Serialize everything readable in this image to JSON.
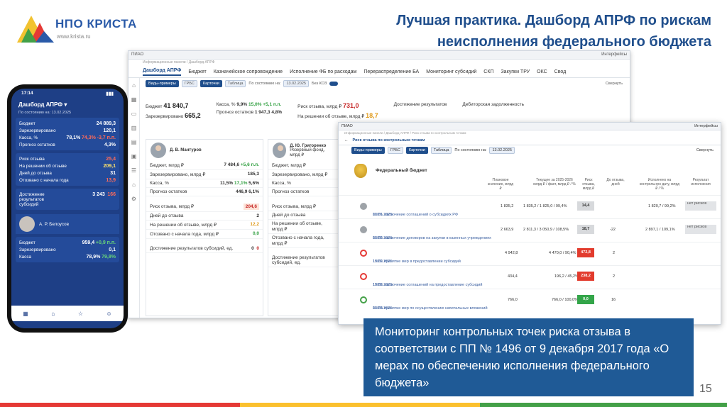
{
  "logo": {
    "name": "НПО КРИСТА",
    "url": "www.krista.ru"
  },
  "slide_title": "Лучшая практика. Дашборд АПРФ по рискам неисполнения федерального бюджета",
  "dashboard": {
    "app": "ПИАО",
    "user": "Интерфейсы",
    "breadcrumb": "Информационные панели / Дашборд АПРФ",
    "tabs": [
      "Дашборд АПРФ",
      "Бюджет",
      "Казначейское сопровождение",
      "Исполнение ФБ по расходам",
      "Перераспределение БА",
      "Мониторинг субсидий",
      "СКП",
      "Закупки ТРУ",
      "ОКС",
      "Свод"
    ],
    "filters": {
      "view1": "Виды-примеры",
      "view2": "ГРБС",
      "view3": "Карточки",
      "view4": "Таблица",
      "date_label": "По состоянию на:",
      "date": "13.02.2025",
      "extra": "Без КОЗ",
      "collapse": "Свернуть"
    },
    "summary": {
      "budget_label": "Бюджет",
      "budget_value": "41 840,7",
      "reserved_label": "Зарезервировано",
      "reserved_value": "665,2",
      "cash_label": "Касса, %",
      "cash_value": "9,9%",
      "cash_plan": "15,0%",
      "cash_delta": "+5,1 п.п.",
      "forecast_label": "Прогноз остатков",
      "forecast_value": "1 947,3",
      "forecast_pct": "4,8%",
      "risk_label": "Риск отзыва, млрд ₽",
      "risk_value": "731,0",
      "decision_label": "На решении об отзыве, млрд ₽",
      "decision_value": "18,7",
      "achieve_label": "Достижение результатов",
      "debt_label": "Дебиторская задолженность"
    },
    "cards": [
      {
        "name": "Д. В. Мантуров",
        "budget": "7 484,6",
        "budget_delta": "+5,6 п.п.",
        "reserved": "185,3",
        "cash_plan": "11,5%",
        "cash_fact": "17,1%",
        "cash_delta": "5,6%",
        "forecast": "446,9",
        "forecast_pct": "6,1%",
        "risk": "204,6",
        "days": "2",
        "decision": "12,2",
        "returned": "0,0",
        "results_plan": "0",
        "results_fact": "0"
      },
      {
        "name": "Д. Ю. Григоренко",
        "sub": "Резервный фонд, млрд ₽"
      }
    ],
    "card_labels": {
      "budget": "Бюджет, млрд ₽",
      "reserved": "Зарезервировано, млрд ₽",
      "cash": "Касса, %",
      "forecast": "Прогноз остатков",
      "risk": "Риск отзыва, млрд ₽",
      "days": "Дней до отзыва",
      "decision": "На решении об отзыве, млрд ₽",
      "returned": "Отозвано с начала года, млрд ₽",
      "results": "Достижение результатов субсидий, ед."
    }
  },
  "window2": {
    "app": "ПИАО",
    "breadcrumb": "Информационные панели / Дашборд АПРФ / Риск отзыва по контрольным точкам",
    "tab": "Риск отзыва по контрольным точкам",
    "section": "Федеральный бюджет",
    "headers": [
      "Плановое значение, млрд ₽",
      "Текущее за 2025-2026 млрд ₽ / факт, млрд ₽ / %",
      "Риск отзыва, млрд ₽",
      "До отзыва, дней",
      "Исполнено на контрольную дату, млрд ₽ / %",
      "Результат исполнения"
    ],
    "rows": [
      {
        "date": "01.01.2025",
        "text": "100% заключение соглашений о субсидиях РФ",
        "status": "grey",
        "plan": "1 835,2",
        "current": "1 835,2 / 1 825,0 / 99,4%",
        "risk": "14,4",
        "days": "",
        "done": "1 820,7 / 99,2%",
        "result": "нет рисков"
      },
      {
        "date": "01.02.2025",
        "text": "100% заключение договоров на закупки в казенных учреждениях",
        "status": "grey",
        "plan": "2 663,9",
        "current": "2 811,3 / 3 050,9 / 108,5%",
        "risk": "18,7",
        "days": "-22",
        "done": "2 897,1 / 109,1%",
        "result": "нет рисков"
      },
      {
        "date": "15.02.2025",
        "text": "100% принятие мер в предоставлении субсидий",
        "status": "red",
        "plan": "4 942,8",
        "current": "4 470,0 / 90,4%",
        "risk": "472,8",
        "days": "2",
        "done": "",
        "result": ""
      },
      {
        "date": "15.02.2025",
        "text": "100% заключение соглашений на предоставление субсидий",
        "status": "red",
        "plan": "434,4",
        "current": "196,2 / 45,2%",
        "risk": "238,2",
        "days": "2",
        "done": "",
        "result": ""
      },
      {
        "date": "01.03.2025",
        "text": "100% принятие мер по осуществлению капитальных вложений",
        "status": "green",
        "plan": "766,0",
        "current": "766,0 / 100,0%",
        "risk": "0,0",
        "days": "16",
        "done": "",
        "result": ""
      }
    ]
  },
  "phone": {
    "time": "17:14",
    "title": "Дашборд АПРФ",
    "date": "По состоянию на: 13.02.2025",
    "rows": [
      {
        "label": "Бюджет",
        "value": "24 889,3"
      },
      {
        "label": "Зарезервировано",
        "value": "120,1"
      },
      {
        "label": "Касса, %",
        "value": "78,1%",
        "plan": "74,3%",
        "delta": "-3,7 п.п."
      },
      {
        "label": "Прогноз остатков",
        "value": "4,3%"
      },
      {
        "label": "Риск отзыва",
        "value": "25,4"
      },
      {
        "label": "На решении об отзыве",
        "value": "209,1"
      },
      {
        "label": "Дней до отзыва",
        "value": "31"
      },
      {
        "label": "Отозвано с начала года",
        "value": "13,9"
      },
      {
        "label": "Достижение результатов субсидий",
        "value": "3 243",
        "fact": "166"
      }
    ],
    "person": "А. Р. Белоусов",
    "person_rows": [
      {
        "label": "Бюджет",
        "value": "959,4",
        "delta": "+0,9 п.п."
      },
      {
        "label": "Зарезервировано",
        "value": "0,1"
      },
      {
        "label": "Касса",
        "value": "78,9%",
        "plan": "79,8%"
      }
    ],
    "nav": [
      "Панели",
      "Главная",
      "Избранное",
      "Профиль"
    ]
  },
  "caption": "Мониторинг контрольных точек риска отзыва в соответствии с ПП № 1496 от 9 декабря 2017 года «О мерах по обеспечению исполнения федерального бюджета»",
  "page_number": "15",
  "colors": {
    "brand_blue": "#1f4e8c",
    "caption_bg": "#1f5a96",
    "risk_red": "#e23b2d",
    "ok_green": "#33a549"
  }
}
